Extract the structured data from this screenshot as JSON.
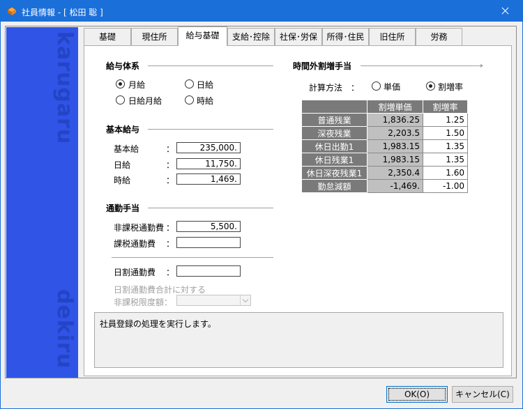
{
  "window": {
    "title": "社員情報 - [ 松田 聡 ]"
  },
  "side": {
    "top_text": "karugaru",
    "bottom_text": "dekiru"
  },
  "tabs": [
    {
      "label": "基礎"
    },
    {
      "label": "現住所"
    },
    {
      "label": "給与基礎"
    },
    {
      "label": "支給･控除"
    },
    {
      "label": "社保･労保"
    },
    {
      "label": "所得･住民"
    },
    {
      "label": "旧住所"
    },
    {
      "label": "労務"
    }
  ],
  "active_tab": "給与基礎",
  "pay_system": {
    "title": "給与体系",
    "options": [
      {
        "label": "月給",
        "checked": true
      },
      {
        "label": "日給",
        "checked": false
      },
      {
        "label": "日給月給",
        "checked": false
      },
      {
        "label": "時給",
        "checked": false
      }
    ]
  },
  "base_pay": {
    "title": "基本給与",
    "colon": "：",
    "fields": [
      {
        "label": "基本給",
        "value": "235,000."
      },
      {
        "label": "日給",
        "value": "11,750."
      },
      {
        "label": "時給",
        "value": "1,469."
      }
    ]
  },
  "commute": {
    "title": "通勤手当",
    "colon": "：",
    "fields": [
      {
        "label": "非課税通勤費",
        "value": "5,500."
      },
      {
        "label": "課税通勤費",
        "value": ""
      }
    ],
    "daily_label": "日割通勤費",
    "daily_value": "",
    "limit_label_1": "日割通勤費合計に対する",
    "limit_label_2": "非課税限度額：",
    "limit_value": ""
  },
  "overtime": {
    "title": "時間外割増手当",
    "calc_label": "計算方法　：",
    "calc_options": [
      {
        "label": "単価",
        "checked": false
      },
      {
        "label": "割増率",
        "checked": true
      }
    ],
    "columns": [
      "割増単価",
      "割増率"
    ],
    "rows": [
      {
        "name": "普通残業",
        "unit": "1,836.25",
        "rate": "1.25"
      },
      {
        "name": "深夜残業",
        "unit": "2,203.5",
        "rate": "1.50"
      },
      {
        "name": "休日出勤1",
        "unit": "1,983.15",
        "rate": "1.35"
      },
      {
        "name": "休日残業1",
        "unit": "1,983.15",
        "rate": "1.35"
      },
      {
        "name": "休日深夜残業1",
        "unit": "2,350.4",
        "rate": "1.60"
      },
      {
        "name": "勤怠減額",
        "unit": "-1,469.",
        "rate": "-1.00"
      }
    ]
  },
  "message": "社員登録の処理を実行します。",
  "buttons": {
    "ok": "OK(O)",
    "cancel": "キャンセル(C)"
  },
  "colors": {
    "titlebar": "#1b6fd8",
    "side_banner": "#2f54e6",
    "table_header": "#7a7a7a"
  }
}
